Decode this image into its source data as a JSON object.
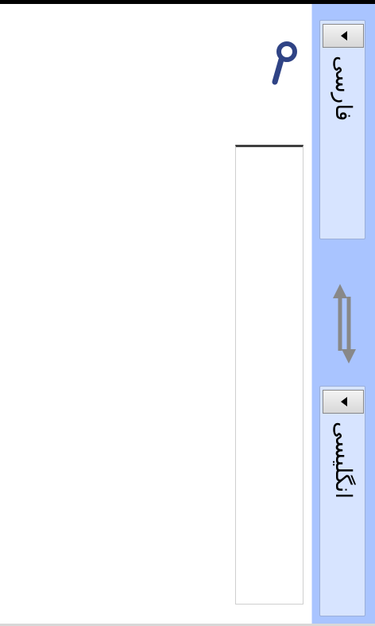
{
  "app": {
    "colors": {
      "sidebar_bg": "#a9c4ff",
      "lang_box_bg": "#d7e4ff",
      "search_icon": "#2f4385",
      "swap_icon": "#888888"
    }
  },
  "toolbar": {
    "search_icon": "search-icon",
    "swap_icon": "swap-languages-icon"
  },
  "language_selector": {
    "source": {
      "label": "فارسی",
      "dropdown_icon": "chevron-left-icon"
    },
    "target": {
      "label": "انگلیسی",
      "dropdown_icon": "chevron-left-icon"
    }
  },
  "input": {
    "value": ""
  }
}
